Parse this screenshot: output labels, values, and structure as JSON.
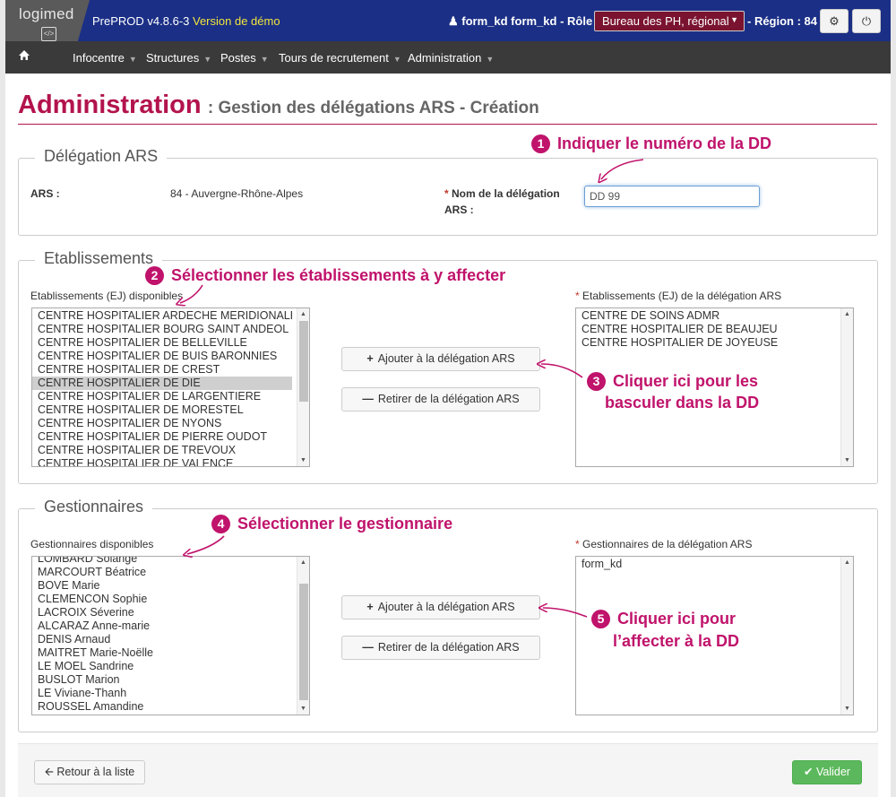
{
  "topbar": {
    "logo": "logimed",
    "version": "PrePROD v4.8.6-3",
    "demo": "Version de démo",
    "user": "form_kd form_kd - Rôle :",
    "role": "Bureau des PH, régional",
    "region": "- Région : 84"
  },
  "nav": {
    "items": [
      "Infocentre",
      "Structures",
      "Postes",
      "Tours de recrutement",
      "Administration"
    ]
  },
  "page": {
    "title": "Administration",
    "subtitle": ": Gestion des délégations ARS - Création"
  },
  "delegation": {
    "legend": "Délégation ARS",
    "ars_label": "ARS :",
    "ars_value": "84 - Auvergne-Rhône-Alpes",
    "required_mark": "*",
    "name_label_1": "Nom de la délégation",
    "name_label_2": "ARS :",
    "name_value": "DD 99"
  },
  "etablissements": {
    "legend": "Etablissements",
    "available_label": "Etablissements (EJ) disponibles",
    "selected_label": "Etablissements (EJ) de la délégation ARS",
    "available": [
      "CENTRE HOSPITALIER ARDECHE MERIDIONALE",
      "CENTRE HOSPITALIER BOURG SAINT ANDEOL",
      "CENTRE HOSPITALIER DE BELLEVILLE",
      "CENTRE HOSPITALIER DE BUIS BARONNIES",
      "CENTRE HOSPITALIER DE CREST",
      "CENTRE HOSPITALIER DE DIE",
      "CENTRE HOSPITALIER DE LARGENTIERE",
      "CENTRE HOSPITALIER DE MORESTEL",
      "CENTRE HOSPITALIER DE NYONS",
      "CENTRE HOSPITALIER DE PIERRE OUDOT",
      "CENTRE HOSPITALIER DE TREVOUX",
      "CENTRE HOSPITALIER DE VALENCE"
    ],
    "selected": [
      "CENTRE DE SOINS ADMR",
      "CENTRE HOSPITALIER DE BEAUJEU",
      "CENTRE HOSPITALIER DE JOYEUSE"
    ],
    "highlighted": "CENTRE HOSPITALIER DE DIE",
    "add_label": "Ajouter à la délégation ARS",
    "remove_label": "Retirer de la délégation ARS"
  },
  "gestionnaires": {
    "legend": "Gestionnaires",
    "available_label": "Gestionnaires disponibles",
    "selected_label": "Gestionnaires de la délégation ARS",
    "available": [
      "LOMBARD Solange",
      "MARCOURT Béatrice",
      "BOVE Marie",
      "CLEMENCON Sophie",
      "LACROIX Séverine",
      "ALCARAZ Anne-marie",
      "DENIS Arnaud",
      "MAITRET Marie-Noëlle",
      "LE MOEL Sandrine",
      "BUSLOT Marion",
      "LE Viviane-Thanh",
      "ROUSSEL Amandine"
    ],
    "selected": [
      "form_kd"
    ],
    "add_label": "Ajouter à la délégation ARS",
    "remove_label": "Retirer de la délégation ARS"
  },
  "footer": {
    "back_label": "Retour à la liste",
    "submit_label": "Valider"
  },
  "annotations": {
    "a1": {
      "num": "1",
      "text": "Indiquer le numéro de la DD"
    },
    "a2": {
      "num": "2",
      "text": "Sélectionner les établissements à y affecter"
    },
    "a3": {
      "num": "3",
      "line1": "Cliquer ici pour les",
      "line2": "basculer dans la DD"
    },
    "a4": {
      "num": "4",
      "text": "Sélectionner le gestionnaire"
    },
    "a5": {
      "num": "5",
      "line1": "Cliquer ici pour",
      "line2": "l’affecter à la DD"
    }
  },
  "colors": {
    "topbar": "#1b2f86",
    "navbar": "#3a3a3a",
    "accent": "#b3134d",
    "annotation": "#c0136b",
    "success": "#5cb85c"
  }
}
